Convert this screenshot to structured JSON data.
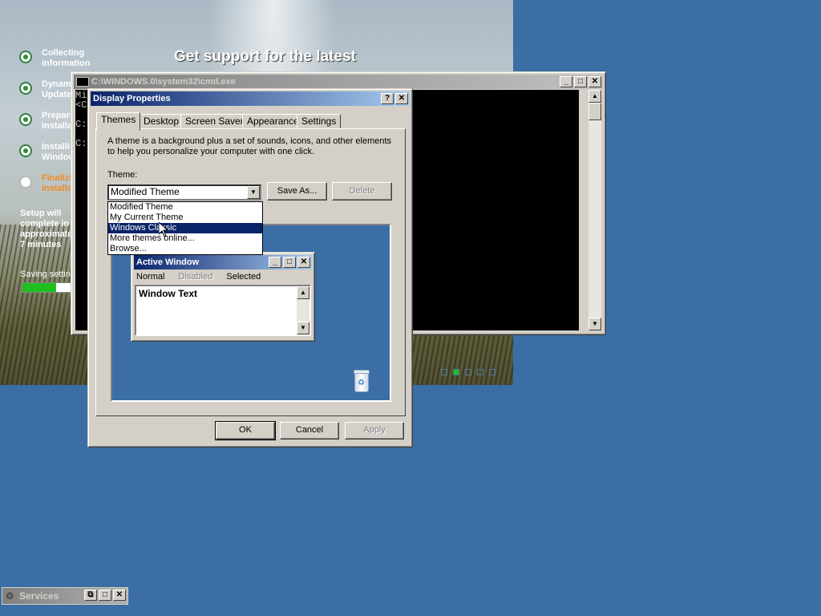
{
  "setup": {
    "headline": "Get support for the latest",
    "steps": [
      {
        "label": "Collecting information",
        "state": "done"
      },
      {
        "label": "Dynamic Update",
        "state": "done"
      },
      {
        "label": "Preparing installation",
        "state": "done"
      },
      {
        "label": "Installing Windows",
        "state": "done"
      },
      {
        "label": "Finalizing installation",
        "state": "current"
      }
    ],
    "estimate": "Setup will complete in approximately: 7 minutes",
    "saving_label": "Saving settings",
    "progress_fraction": 0.7
  },
  "cmd": {
    "title": "C:\\WINDOWS.0\\system32\\cmd.exe",
    "lines": [
      "Mi",
      "<C",
      "",
      "C:",
      "",
      "C:"
    ]
  },
  "display_properties": {
    "title": "Display Properties",
    "tabs": [
      "Themes",
      "Desktop",
      "Screen Saver",
      "Appearance",
      "Settings"
    ],
    "selected_tab": "Themes",
    "description": "A theme is a background plus a set of sounds, icons, and other elements to help you personalize your computer with one click.",
    "theme_label": "Theme:",
    "theme_value": "Modified Theme",
    "save_as_label": "Save As...",
    "delete_label": "Delete",
    "dropdown_options": [
      "Modified Theme",
      "My Current Theme",
      "Windows Classic",
      "More themes online...",
      "Browse..."
    ],
    "dropdown_highlighted": "Windows Classic",
    "preview": {
      "window_title": "Active Window",
      "menu_items": [
        "Normal",
        "Disabled",
        "Selected"
      ],
      "window_text": "Window Text"
    },
    "ok_label": "OK",
    "cancel_label": "Cancel",
    "apply_label": "Apply"
  },
  "services_bar": {
    "title": "Services"
  },
  "colors": {
    "desktop": "#3a6ea5",
    "active_title": "#0a246a",
    "highlight": "#0a246a"
  }
}
